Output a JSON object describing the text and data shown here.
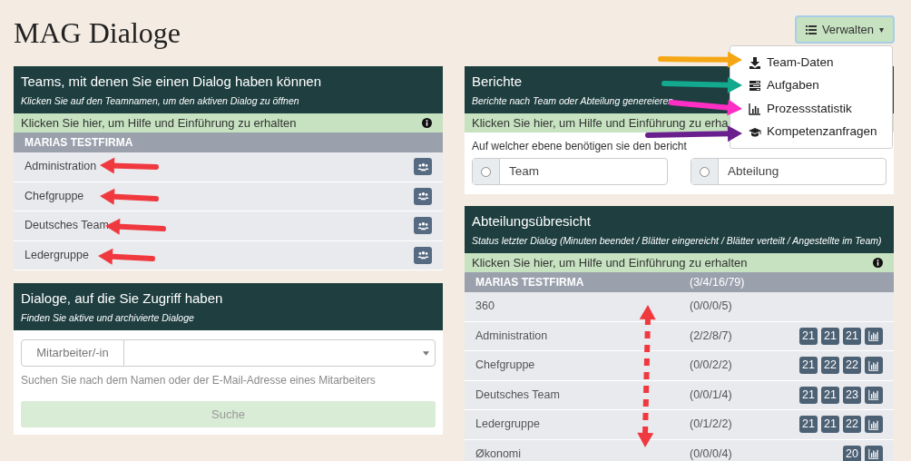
{
  "page_title": "MAG Dialoge",
  "manage_button": {
    "label": "Verwalten",
    "caret": "▾",
    "expanded": true
  },
  "manage_menu": [
    {
      "label": "Team-Daten",
      "kind": "download"
    },
    {
      "label": "Aufgaben",
      "kind": "tasks"
    },
    {
      "label": "Prozessstatistik",
      "kind": "chart"
    },
    {
      "label": "Kompetenzanfragen",
      "kind": "graduation"
    }
  ],
  "teams_card": {
    "title": "Teams, mit denen Sie einen Dialog haben können",
    "subtitle": "Klicken Sie auf den Teamnamen, um den aktiven Dialog zu öffnen",
    "help": "Klicken Sie hier, um Hilfe und Einführung zu erhalten",
    "company": "MARIAS TESTFIRMA",
    "teams": [
      {
        "name": "Administration"
      },
      {
        "name": "Chefgruppe"
      },
      {
        "name": "Deutsches Team"
      },
      {
        "name": "Ledergruppe"
      }
    ]
  },
  "search_card": {
    "title": "Dialoge, auf die Sie Zugriff haben",
    "subtitle": "Finden Sie aktive und archivierte Dialoge",
    "field_label": "Mitarbeiter/-in",
    "hint": "Suchen Sie nach dem Namen oder der E-Mail-Adresse eines Mitarbeiters",
    "button": {
      "label": "Suche",
      "disabled": true
    }
  },
  "reports_card": {
    "title": "Berichte",
    "subtitle": "Berichte nach Team oder Abteilung genereieren",
    "help": "Klicken Sie hier, um Hilfe und Einführung zu erha",
    "question": "Auf welcher ebene benötigen sie den bericht",
    "options": [
      {
        "label": "Team",
        "selected": false
      },
      {
        "label": "Abteilung",
        "selected": false
      }
    ]
  },
  "overview_card": {
    "title": "Abteilungsübresicht",
    "subtitle": "Status letzter Dialog (Minuten beendet / Blätter eingereicht / Blätter verteilt / Angestellte im Team)",
    "help": "Klicken Sie hier, um Hilfe und Einführung zu erhalten",
    "company": {
      "name": "MARIAS TESTFIRMA",
      "status": "(3/4/16/79)"
    },
    "rows": [
      {
        "name": "360",
        "status": "(0/0/0/5)",
        "chart_button": false
      },
      {
        "name": "Administration",
        "status": "(2/2/8/7)",
        "badges": [
          "21",
          "21",
          "21"
        ],
        "chart_button": true
      },
      {
        "name": "Chefgruppe",
        "status": "(0/0/2/2)",
        "badges": [
          "21",
          "22",
          "22"
        ],
        "chart_button": true
      },
      {
        "name": "Deutsches Team",
        "status": "(0/0/1/4)",
        "badges": [
          "21",
          "21",
          "23"
        ],
        "chart_button": true
      },
      {
        "name": "Ledergruppe",
        "status": "(0/1/2/2)",
        "badges": [
          "21",
          "21",
          "22"
        ],
        "chart_button": true
      },
      {
        "name": "Økonomi",
        "status": "(0/0/0/4)",
        "badges": [
          "20"
        ],
        "chart_button": true
      }
    ]
  }
}
